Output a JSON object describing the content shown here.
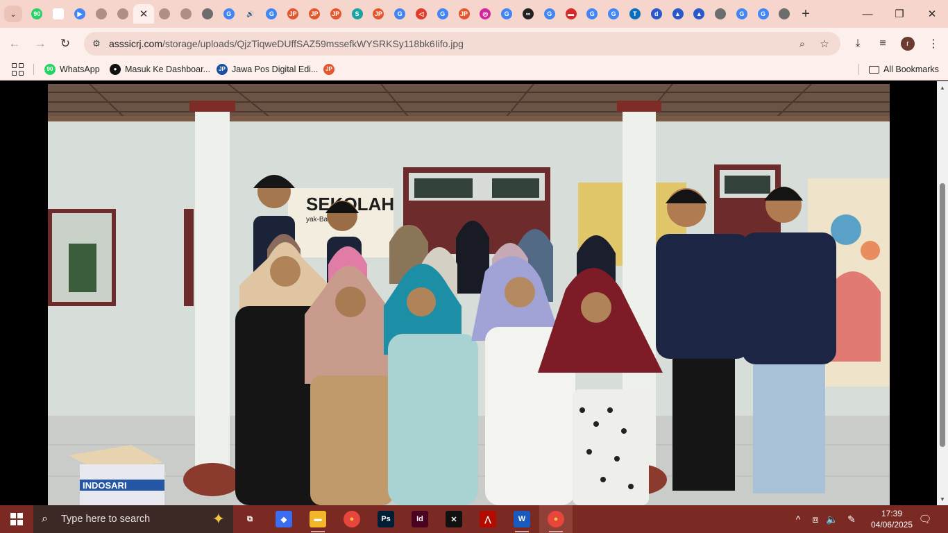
{
  "tabs": [
    {
      "icon": "whatsapp-icon",
      "glyph": "90",
      "color": "#25d366"
    },
    {
      "icon": "blank-page-icon",
      "glyph": "",
      "color": "#ffffff"
    },
    {
      "icon": "play-store-icon",
      "glyph": "▶",
      "color": "#4285f4"
    },
    {
      "icon": "globe-icon",
      "glyph": "",
      "color": "#b08f8a"
    },
    {
      "icon": "globe-icon",
      "glyph": "",
      "color": "#b08f8a"
    },
    {
      "icon": "close-icon",
      "glyph": "✕",
      "color": "",
      "active": true
    },
    {
      "icon": "globe-icon",
      "glyph": "",
      "color": "#b08f8a"
    },
    {
      "icon": "globe-icon",
      "glyph": "",
      "color": "#b08f8a"
    },
    {
      "icon": "shield-icon",
      "glyph": "",
      "color": "#6d6d6d"
    },
    {
      "icon": "google-icon",
      "glyph": "G",
      "color": "#4285f4"
    },
    {
      "icon": "speaker-icon",
      "glyph": "🔊",
      "color": ""
    },
    {
      "icon": "google-icon",
      "glyph": "G",
      "color": "#4285f4"
    },
    {
      "icon": "jp-icon",
      "glyph": "JP",
      "color": "#e4572e"
    },
    {
      "icon": "jp-icon",
      "glyph": "JP",
      "color": "#e4572e"
    },
    {
      "icon": "jp-icon",
      "glyph": "JP",
      "color": "#e4572e"
    },
    {
      "icon": "s-icon",
      "glyph": "S",
      "color": "#1aa3a3"
    },
    {
      "icon": "jp-icon",
      "glyph": "JP",
      "color": "#e4572e"
    },
    {
      "icon": "google-icon",
      "glyph": "G",
      "color": "#4285f4"
    },
    {
      "icon": "send-icon",
      "glyph": "◁",
      "color": "#e03b2b"
    },
    {
      "icon": "google-icon",
      "glyph": "G",
      "color": "#4285f4"
    },
    {
      "icon": "jp-icon",
      "glyph": "JP",
      "color": "#e4572e"
    },
    {
      "icon": "instagram-icon",
      "glyph": "◎",
      "color": "#d6249f"
    },
    {
      "icon": "google-icon",
      "glyph": "G",
      "color": "#4285f4"
    },
    {
      "icon": "glasses-icon",
      "glyph": "∞",
      "color": "#222222"
    },
    {
      "icon": "google-icon",
      "glyph": "G",
      "color": "#4285f4"
    },
    {
      "icon": "red-banner-icon",
      "glyph": "▬",
      "color": "#d62b2b"
    },
    {
      "icon": "google-icon",
      "glyph": "G",
      "color": "#4285f4"
    },
    {
      "icon": "google-icon",
      "glyph": "G",
      "color": "#4285f4"
    },
    {
      "icon": "t-icon",
      "glyph": "T",
      "color": "#0a6ebd"
    },
    {
      "icon": "d-icon",
      "glyph": "d",
      "color": "#2a57c9"
    },
    {
      "icon": "flag-icon",
      "glyph": "▲",
      "color": "#2a57c9"
    },
    {
      "icon": "flag-icon",
      "glyph": "▲",
      "color": "#2a57c9"
    },
    {
      "icon": "shield-icon",
      "glyph": "",
      "color": "#6d6d6d"
    },
    {
      "icon": "google-icon",
      "glyph": "G",
      "color": "#4285f4"
    },
    {
      "icon": "google-icon",
      "glyph": "G",
      "color": "#4285f4"
    },
    {
      "icon": "shield-icon",
      "glyph": "",
      "color": "#6d6d6d"
    }
  ],
  "toolbar": {
    "url_host": "asssicrj.com",
    "url_path": "/storage/uploads/QjzTiqweDUffSAZ59mssefkWYSRKSy118bk6Iifo.jpg",
    "profile_initial": "r"
  },
  "bookmarks": [
    {
      "label": "WhatsApp",
      "icon": "whatsapp-icon",
      "glyph": "90",
      "color": "#25d366"
    },
    {
      "label": "Masuk Ke Dashboar...",
      "icon": "github-icon",
      "glyph": "●",
      "color": "#111111"
    },
    {
      "label": "Jawa Pos Digital Edi...",
      "icon": "jp-icon",
      "glyph": "JP",
      "color": "#1e50a2"
    },
    {
      "label": "",
      "icon": "jp-icon",
      "glyph": "JP",
      "color": "#e4572e"
    }
  ],
  "all_bookmarks": "All Bookmarks",
  "photo": {
    "box_brand": "INDOSARI",
    "poster_text": "SEKOLAH",
    "poster_sub": "yak-Ba     Ebok"
  },
  "taskbar": {
    "search_placeholder": "Type here to search",
    "apps": [
      {
        "name": "task-view",
        "glyph": "⧉",
        "color": "transparent",
        "open": false
      },
      {
        "name": "copilot",
        "glyph": "◆",
        "color": "#3b6df0",
        "open": false
      },
      {
        "name": "file-explorer",
        "glyph": "▬",
        "color": "#f3b52a",
        "open": true
      },
      {
        "name": "chrome",
        "glyph": "●",
        "color": "#e8453c",
        "open": false
      },
      {
        "name": "photoshop",
        "glyph": "Ps",
        "color": "#001e36",
        "open": false
      },
      {
        "name": "indesign",
        "glyph": "Id",
        "color": "#49021f",
        "open": false
      },
      {
        "name": "capcut",
        "glyph": "✕",
        "color": "#111111",
        "open": false
      },
      {
        "name": "acrobat",
        "glyph": "⋀",
        "color": "#b30b00",
        "open": false
      },
      {
        "name": "word",
        "glyph": "W",
        "color": "#185abd",
        "open": true
      },
      {
        "name": "chrome-profile",
        "glyph": "●",
        "color": "#e8453c",
        "open": true,
        "active": true
      }
    ],
    "time": "17:39",
    "date": "04/06/2025"
  }
}
